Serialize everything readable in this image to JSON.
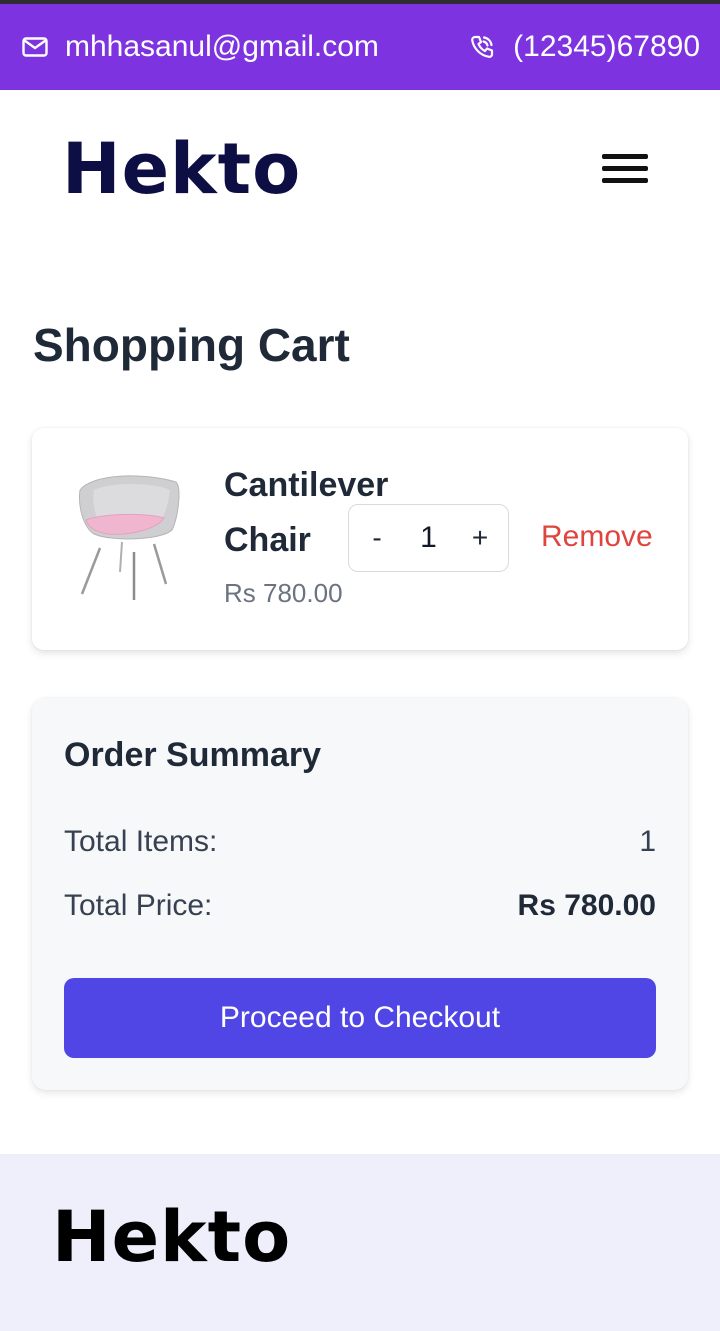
{
  "topbar": {
    "email": "mhhasanul@gmail.com",
    "phone": "(12345)67890",
    "email_icon": "mail-icon",
    "phone_icon": "phone-icon",
    "background": "#7e33e0"
  },
  "header": {
    "logo": "Hekto",
    "menu_icon": "hamburger-icon"
  },
  "page": {
    "title": "Shopping Cart"
  },
  "cart": {
    "items": [
      {
        "name": "Cantilever Chair",
        "price": "Rs 780.00",
        "quantity": "1",
        "decrement_label": "-",
        "increment_label": "+",
        "remove_label": "Remove",
        "image_icon": "chair-image"
      }
    ]
  },
  "summary": {
    "title": "Order Summary",
    "total_items_label": "Total Items:",
    "total_items_value": "1",
    "total_price_label": "Total Price:",
    "total_price_value": "Rs 780.00",
    "checkout_label": "Proceed to Checkout",
    "checkout_color": "#4f46e5"
  },
  "footer": {
    "logo": "Hekto"
  },
  "colors": {
    "remove": "#e0443e",
    "logo": "#0d0e43",
    "footer_bg": "#eeeffb"
  }
}
